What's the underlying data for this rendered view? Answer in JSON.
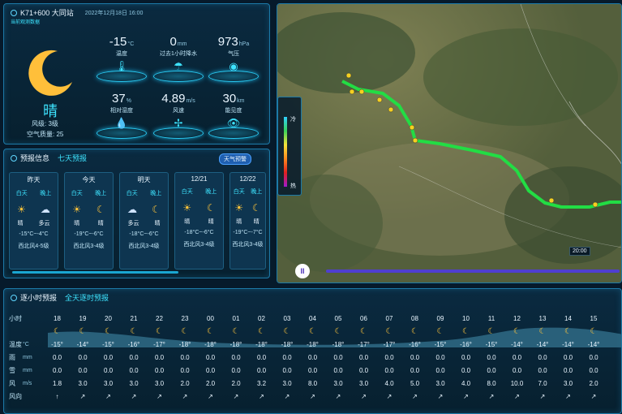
{
  "now": {
    "title": "K71+600 大同站",
    "timestamp": "2022年12月18日 16:00",
    "subtitle": "当前观测数据",
    "condition": "晴",
    "wind_level": "风级: 3级",
    "aqi": "空气质量: 25",
    "metrics": [
      {
        "value": "-15",
        "unit": "°C",
        "label": "温度",
        "icon": "thermometer-icon",
        "glyph": "🌡"
      },
      {
        "value": "0",
        "unit": "mm",
        "label": "过去1小时降水",
        "icon": "rain-gauge-icon",
        "glyph": "☂"
      },
      {
        "value": "973",
        "unit": "hPa",
        "label": "气压",
        "icon": "pressure-icon",
        "glyph": "◉"
      },
      {
        "value": "37",
        "unit": "%",
        "label": "相对湿度",
        "icon": "humidity-icon",
        "glyph": "💧"
      },
      {
        "value": "4.89",
        "unit": "m/s",
        "label": "风速",
        "icon": "fan-icon",
        "glyph": "✢"
      },
      {
        "value": "30",
        "unit": "km",
        "label": "能见度",
        "icon": "eye-icon",
        "glyph": "👁"
      }
    ]
  },
  "forecast": {
    "title": "预报信息",
    "tab": "七天预报",
    "badge": "天气预警",
    "days": [
      {
        "name": "昨天",
        "day": "白天",
        "night": "晚上",
        "day_icon": "sun-icon",
        "night_icon": "cloud-icon",
        "day_cond": "晴",
        "night_cond": "多云",
        "temp": "-15°C~-4°C",
        "wind": "西北风4-5级"
      },
      {
        "name": "今天",
        "day": "白天",
        "night": "晚上",
        "day_icon": "sun-icon",
        "night_icon": "moon-icon",
        "day_cond": "晴",
        "night_cond": "晴",
        "temp": "-19°C~-6°C",
        "wind": "西北风3-4级"
      },
      {
        "name": "明天",
        "day": "白天",
        "night": "晚上",
        "day_icon": "cloud-icon",
        "night_icon": "moon-icon",
        "day_cond": "多云",
        "night_cond": "晴",
        "temp": "-18°C~-6°C",
        "wind": "西北风3-4级"
      },
      {
        "name": "12/21",
        "day": "白天",
        "night": "晚上",
        "day_icon": "sun-icon",
        "night_icon": "moon-icon",
        "day_cond": "晴",
        "night_cond": "晴",
        "temp": "-18°C~-6°C",
        "wind": "西北风3-4级"
      },
      {
        "name": "12/22",
        "day": "白天",
        "night": "晚上",
        "day_icon": "sun-icon",
        "night_icon": "moon-icon",
        "day_cond": "晴",
        "night_cond": "晴",
        "temp": "-19°C~-7°C",
        "wind": "西北风3-4级"
      }
    ]
  },
  "map": {
    "legend_top": "冷",
    "legend_bottom": "热",
    "time": "20:00",
    "play": "II"
  },
  "hourly": {
    "title": "逐小时预报",
    "tab": "全天逐时预报",
    "row_labels": [
      "小时",
      "",
      "温度",
      "雨",
      "雪",
      "风",
      "风向"
    ],
    "units": [
      "",
      "",
      "°C",
      "mm",
      "mm",
      "m/s",
      ""
    ],
    "hours": [
      "18",
      "19",
      "20",
      "21",
      "22",
      "23",
      "00",
      "01",
      "02",
      "03",
      "04",
      "05",
      "06",
      "07",
      "08",
      "09",
      "10",
      "11",
      "12",
      "13",
      "14",
      "15"
    ],
    "temps": [
      "-15°",
      "-14°",
      "-15°",
      "-16°",
      "-17°",
      "-18°",
      "-18°",
      "-18°",
      "-18°",
      "-18°",
      "-18°",
      "-18°",
      "-17°",
      "-17°",
      "-16°",
      "-15°",
      "-16°",
      "-15°",
      "-14°",
      "-14°",
      "-14°",
      "-14°"
    ],
    "rain": [
      "0.0",
      "0.0",
      "0.0",
      "0.0",
      "0.0",
      "0.0",
      "0.0",
      "0.0",
      "0.0",
      "0.0",
      "0.0",
      "0.0",
      "0.0",
      "0.0",
      "0.0",
      "0.0",
      "0.0",
      "0.0",
      "0.0",
      "0.0",
      "0.0",
      "0.0"
    ],
    "snow": [
      "0.0",
      "0.0",
      "0.0",
      "0.0",
      "0.0",
      "0.0",
      "0.0",
      "0.0",
      "0.0",
      "0.0",
      "0.0",
      "0.0",
      "0.0",
      "0.0",
      "0.0",
      "0.0",
      "0.0",
      "0.0",
      "0.0",
      "0.0",
      "0.0",
      "0.0"
    ],
    "wind": [
      "1.8",
      "3.0",
      "3.0",
      "3.0",
      "3.0",
      "2.0",
      "2.0",
      "2.0",
      "3.2",
      "3.0",
      "8.0",
      "3.0",
      "3.0",
      "4.0",
      "5.0",
      "3.0",
      "4.0",
      "8.0",
      "10.0",
      "7.0",
      "3.0",
      "2.0"
    ],
    "dir": [
      "↑",
      "↗",
      "↗",
      "↗",
      "↗",
      "↗",
      "↗",
      "↗",
      "↗",
      "↗",
      "↗",
      "↗",
      "↗",
      "↗",
      "↗",
      "↗",
      "↗",
      "↗",
      "↗",
      "↗",
      "↗",
      "↗"
    ]
  }
}
